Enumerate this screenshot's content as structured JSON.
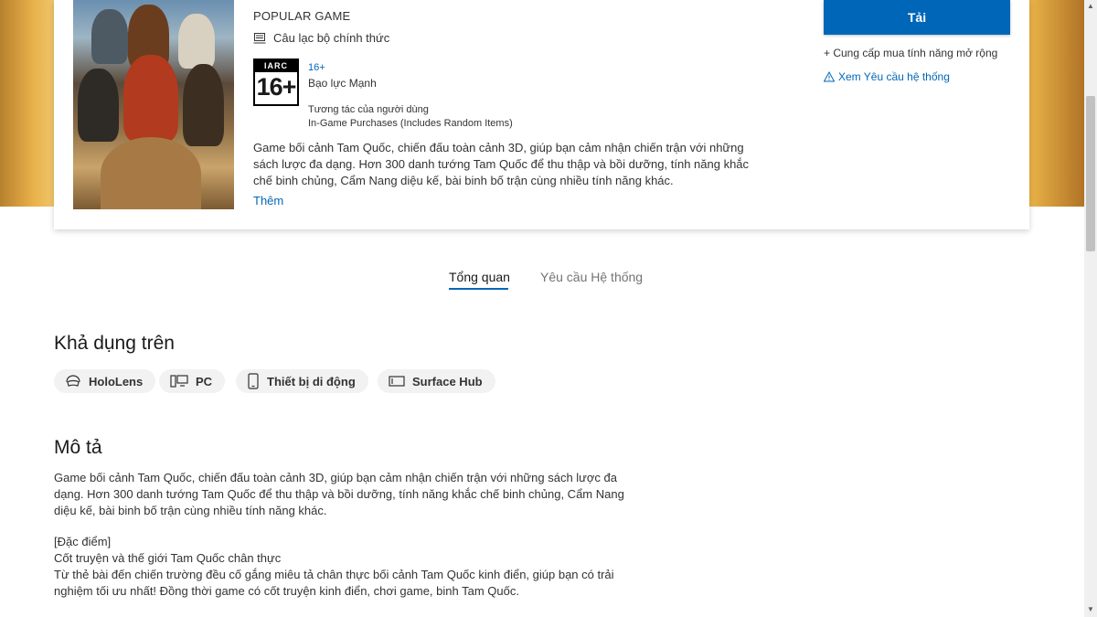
{
  "product": {
    "category": "POPULAR GAME",
    "club": "Câu lạc bộ chính thức",
    "rating_badge_top": "IARC",
    "rating_badge_age": "16+",
    "rating_link": "16+",
    "rating_descriptor": "Bạo lực Mạnh",
    "interaction_1": "Tương tác của người dùng",
    "interaction_2": "In-Game Purchases (Includes Random Items)",
    "summary": "Game bối cảnh Tam Quốc, chiến đấu toàn cảnh 3D, giúp bạn cảm nhận chiến trận với những sách lược đa dạng. Hơn 300 danh tướng Tam Quốc để thu thập và bồi dưỡng, tính năng khắc chế binh chủng, Cẩm Nang diệu kế, bài binh bố trận cùng nhiều tính năng khác.",
    "more_link": "Thêm",
    "get_button": "Tải",
    "in_app": "+ Cung cấp mua tính năng mở rộng",
    "sysreq_link": "Xem Yêu cầu hệ thống"
  },
  "tabs": [
    {
      "label": "Tổng quan",
      "active": true
    },
    {
      "label": "Yêu cầu Hệ thống",
      "active": false
    }
  ],
  "available": {
    "heading": "Khả dụng trên",
    "devices": [
      {
        "label": "HoloLens",
        "icon": "hololens-icon"
      },
      {
        "label": "PC",
        "icon": "pc-icon"
      },
      {
        "label": "Thiết bị di động",
        "icon": "mobile-device-icon"
      },
      {
        "label": "Surface Hub",
        "icon": "surface-hub-icon"
      }
    ]
  },
  "description": {
    "heading": "Mô tả",
    "para1": "Game bối cảnh Tam Quốc, chiến đấu toàn cảnh 3D, giúp bạn cảm nhận chiến trận với những sách lược đa dạng. Hơn 300 danh tướng Tam Quốc để thu thập và bồi dưỡng, tính năng khắc chế binh chủng, Cẩm Nang diệu kế, bài binh bố trận cùng nhiều tính năng khác.",
    "features_label": "[Đặc điểm]",
    "feature1_title": "Cốt truyện và thế giới Tam Quốc chân thực",
    "feature1_text": "Từ thẻ bài đến chiến trường đều cố gắng miêu tả chân thực bối cảnh Tam Quốc kinh điển, giúp bạn có trải nghiệm tối ưu nhất! Đồng thời game có cốt truyện kinh điển, chơi game, binh Tam Quốc."
  },
  "colors": {
    "accent": "#0067b8",
    "pill_bg": "#f2f2f2"
  }
}
